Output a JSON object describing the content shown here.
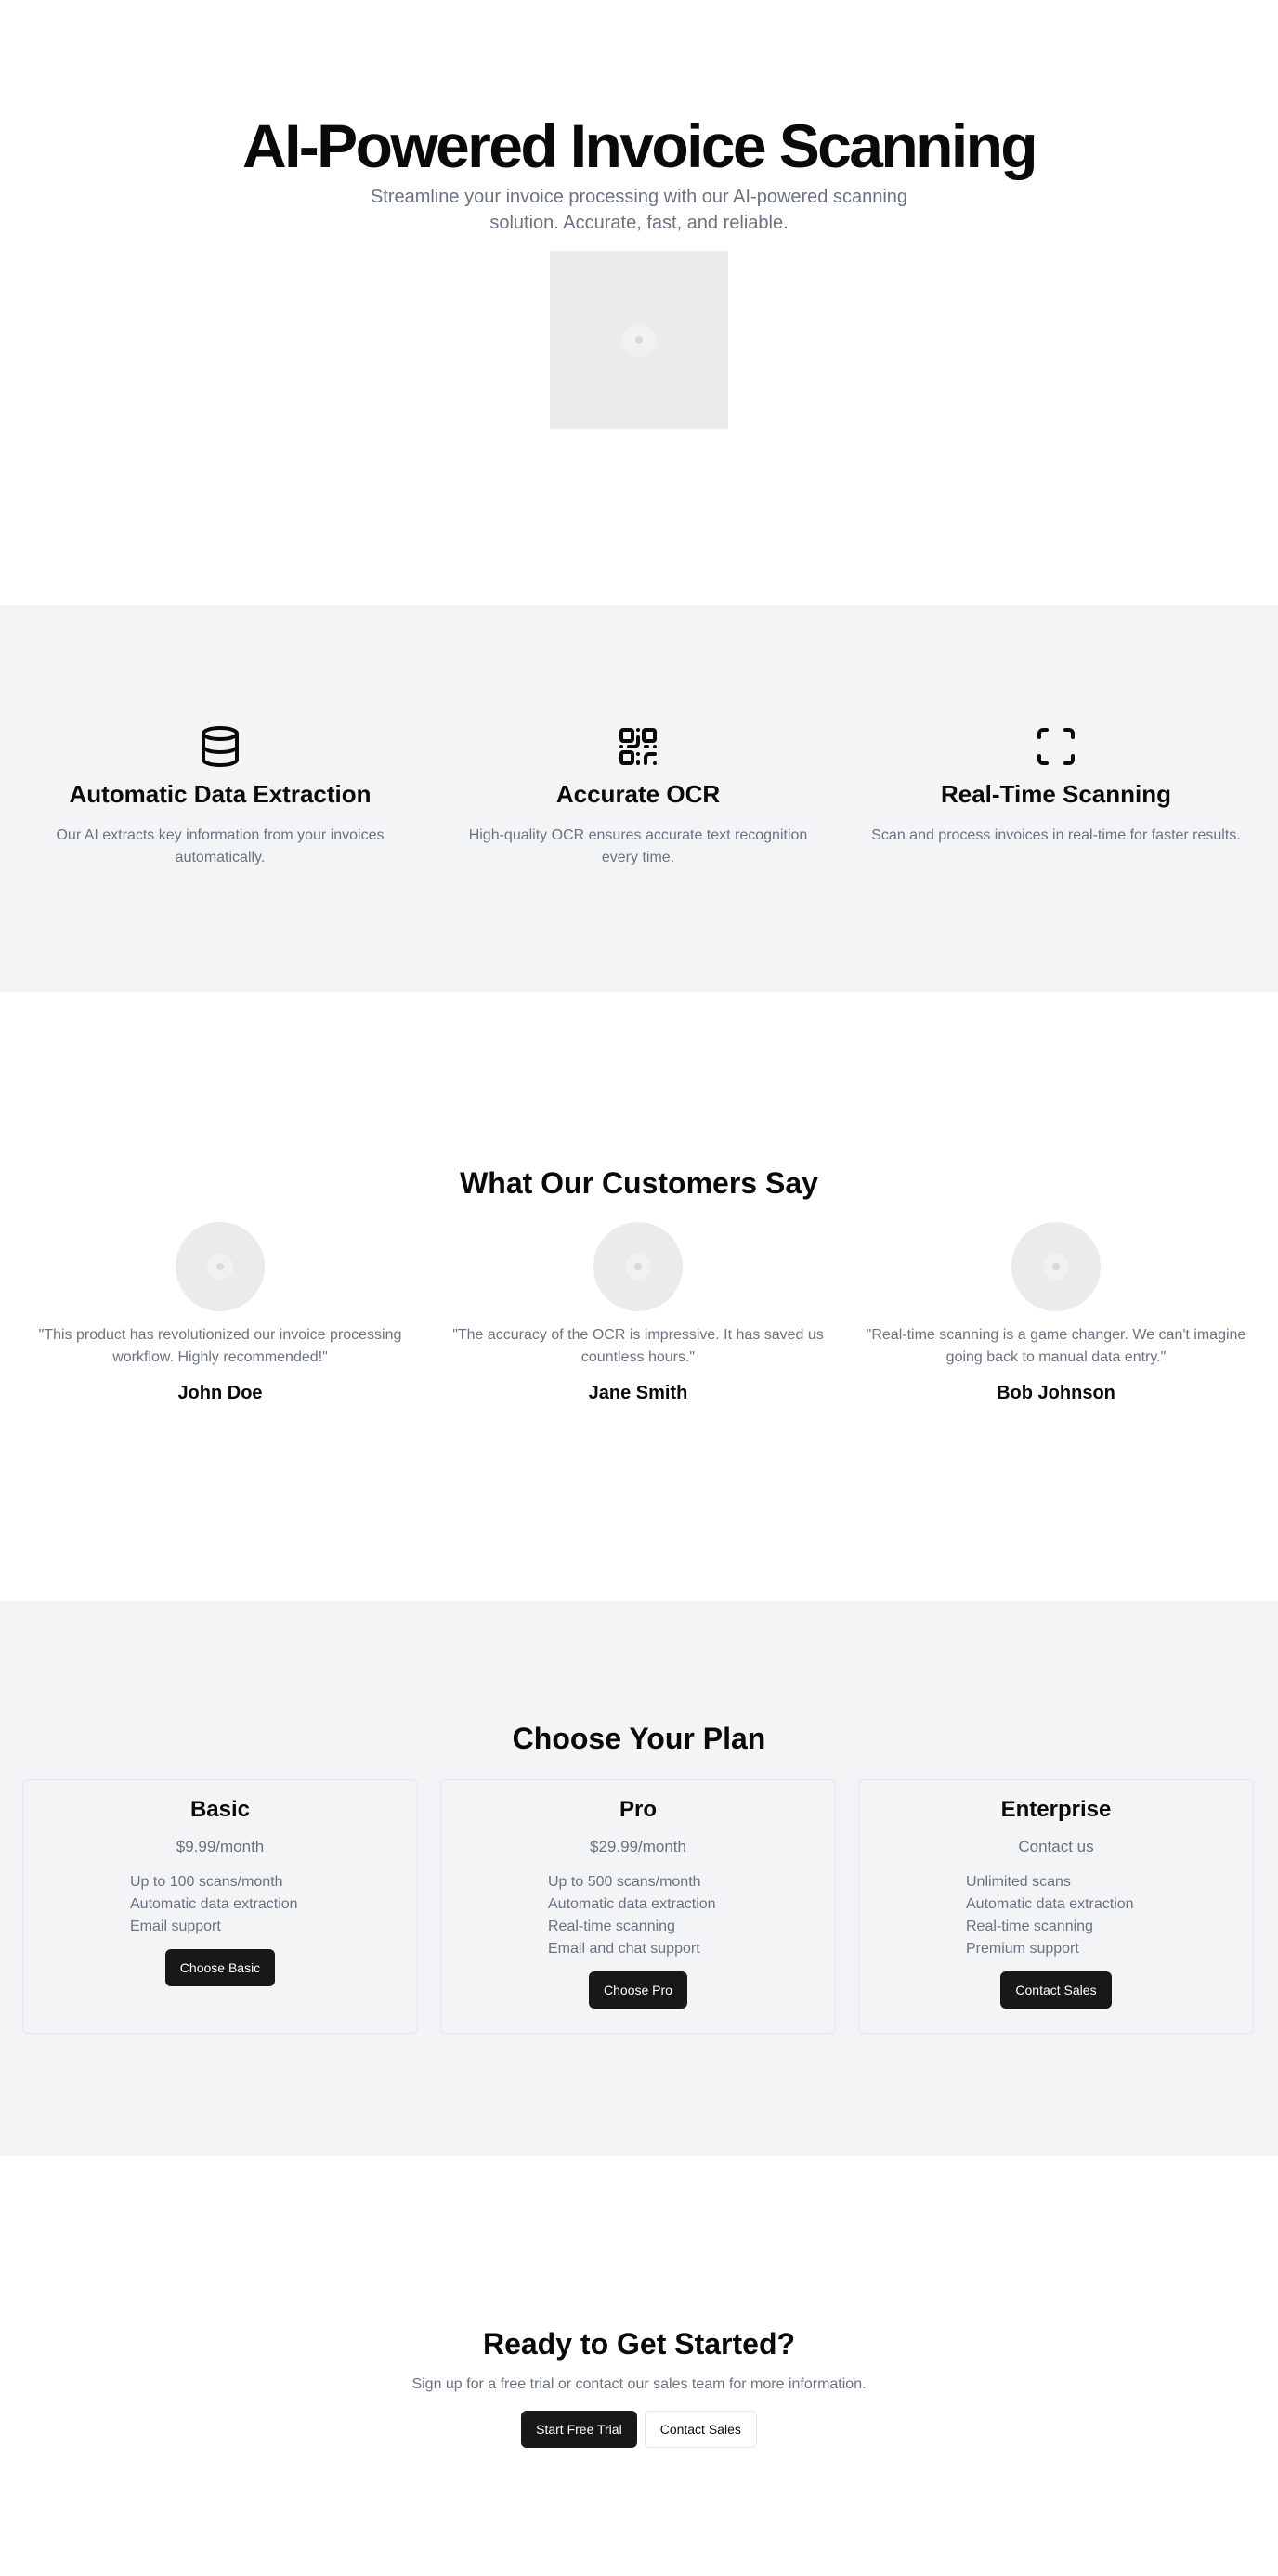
{
  "hero": {
    "title": "AI-Powered Invoice Scanning",
    "subtitle": "Streamline your invoice processing with our AI-powered scanning solution. Accurate, fast, and reliable.",
    "image_icon": "image-placeholder-icon"
  },
  "features": [
    {
      "icon": "database-icon",
      "title": "Automatic Data Extraction",
      "description": "Our AI extracts key information from your invoices automatically."
    },
    {
      "icon": "qr-code-icon",
      "title": "Accurate OCR",
      "description": "High-quality OCR ensures accurate text recognition every time."
    },
    {
      "icon": "scan-frame-icon",
      "title": "Real-Time Scanning",
      "description": "Scan and process invoices in real-time for faster results."
    }
  ],
  "testimonials": {
    "title": "What Our Customers Say",
    "items": [
      {
        "quote": "\"This product has revolutionized our invoice processing workflow. Highly recommended!\"",
        "author": "John Doe"
      },
      {
        "quote": "\"The accuracy of the OCR is impressive. It has saved us countless hours.\"",
        "author": "Jane Smith"
      },
      {
        "quote": "\"Real-time scanning is a game changer. We can't imagine going back to manual data entry.\"",
        "author": "Bob Johnson"
      }
    ]
  },
  "pricing": {
    "title": "Choose Your Plan",
    "plans": [
      {
        "name": "Basic",
        "price": "$9.99/month",
        "features": [
          "Up to 100 scans/month",
          "Automatic data extraction",
          "Email support"
        ],
        "button": "Choose Basic"
      },
      {
        "name": "Pro",
        "price": "$29.99/month",
        "features": [
          "Up to 500 scans/month",
          "Automatic data extraction",
          "Real-time scanning",
          "Email and chat support"
        ],
        "button": "Choose Pro"
      },
      {
        "name": "Enterprise",
        "price": "Contact us",
        "features": [
          "Unlimited scans",
          "Automatic data extraction",
          "Real-time scanning",
          "Premium support"
        ],
        "button": "Contact Sales"
      }
    ]
  },
  "cta": {
    "title": "Ready to Get Started?",
    "description": "Sign up for a free trial or contact our sales team for more information.",
    "primary_button": "Start Free Trial",
    "secondary_button": "Contact Sales"
  },
  "colors": {
    "text": "#0a0a0a",
    "muted": "#6b7280",
    "section_bg": "#f3f4f6",
    "button_dark": "#18181b"
  }
}
